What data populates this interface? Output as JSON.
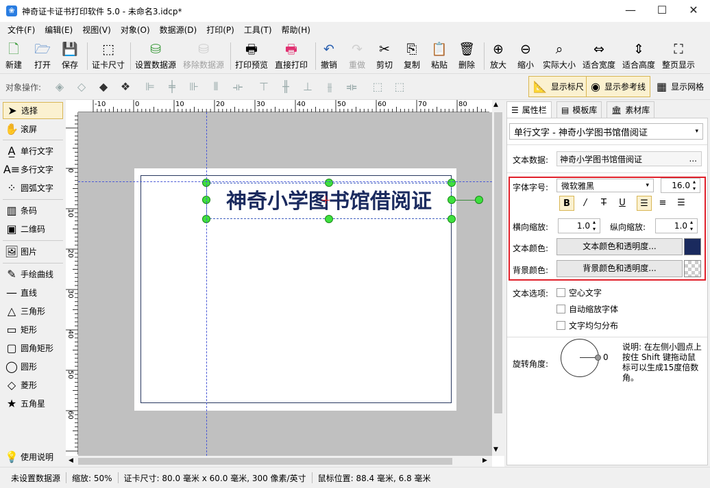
{
  "window": {
    "title": "神奇证卡证书打印软件 5.0 - 未命名3.idcp*"
  },
  "menu": [
    "文件(F)",
    "编辑(E)",
    "视图(V)",
    "对象(O)",
    "数据源(D)",
    "打印(P)",
    "工具(T)",
    "帮助(H)"
  ],
  "toolbar": {
    "new": "新建",
    "open": "打开",
    "save": "保存",
    "card_size": "证卡尺寸",
    "set_datasource": "设置数据源",
    "remove_datasource": "移除数据源",
    "print_preview": "打印预览",
    "direct_print": "直接打印",
    "undo": "撤销",
    "redo": "重做",
    "cut": "剪切",
    "copy": "复制",
    "paste": "粘贴",
    "delete": "删除",
    "zoom_in": "放大",
    "zoom_out": "缩小",
    "actual_size": "实际大小",
    "fit_width": "适合宽度",
    "fit_height": "适合高度",
    "fit_page": "整页显示"
  },
  "objbar": {
    "label": "对象操作:",
    "show_ruler": "显示标尺",
    "show_guides": "显示参考线",
    "show_grid": "显示网格"
  },
  "tools": {
    "select": "选择",
    "scroll": "滚屏",
    "single_text": "单行文字",
    "multi_text": "多行文字",
    "arc_text": "圆弧文字",
    "barcode": "条码",
    "qrcode": "二维码",
    "image": "图片",
    "freehand": "手绘曲线",
    "line": "直线",
    "triangle": "三角形",
    "rect": "矩形",
    "rounded_rect": "圆角矩形",
    "ellipse": "圆形",
    "diamond": "菱形",
    "star": "五角星",
    "help": "使用说明"
  },
  "ruler": {
    "top_ticks": [
      "-10",
      "0",
      "10",
      "20",
      "30",
      "40",
      "50",
      "60",
      "70",
      "80"
    ],
    "left_ticks": [
      "0",
      "10",
      "20",
      "30",
      "40",
      "50",
      "60"
    ]
  },
  "canvas": {
    "title_text": "神奇小学图书馆借阅证"
  },
  "panel": {
    "tabs": [
      "属性栏",
      "模板库",
      "素材库"
    ],
    "object_select": "单行文字 - 神奇小学图书馆借阅证",
    "text_data_label": "文本数据:",
    "text_data_value": "神奇小学图书馆借阅证",
    "ellipsis": "...",
    "font_label": "字体字号:",
    "font_name": "微软雅黑",
    "font_size": "16.0",
    "fmt": {
      "bold": "B",
      "italic": "/",
      "strike": "T",
      "underline": "U"
    },
    "hscale_label": "横向缩放:",
    "hscale": "1.0",
    "vscale_label": "纵向缩放:",
    "vscale": "1.0",
    "text_color_label": "文本颜色:",
    "text_color_btn": "文本颜色和透明度...",
    "bg_color_label": "背景颜色:",
    "bg_color_btn": "背景颜色和透明度...",
    "text_color": "#1a2a5e",
    "text_options_label": "文本选项:",
    "opt_hollow": "空心文字",
    "opt_autoscale": "自动缩放字体",
    "opt_distribute": "文字均匀分布",
    "rotate_label": "旋转角度:",
    "rotate_value": "0",
    "rotate_note": "说明: 在左侧小圆点上按住 Shift 键拖动鼠标可以生成15度倍数角。"
  },
  "status": {
    "datasource": "未设置数据源",
    "zoom": "缩放: 50%",
    "card_size": "证卡尺寸: 80.0 毫米 x 60.0 毫米, 300 像素/英寸",
    "mouse_pos": "鼠标位置: 88.4 毫米, 6.8 毫米"
  },
  "colors": {
    "accent_active": "#fbf1d0",
    "highlight_box": "#e0202a",
    "handle": "#3ee03e"
  }
}
